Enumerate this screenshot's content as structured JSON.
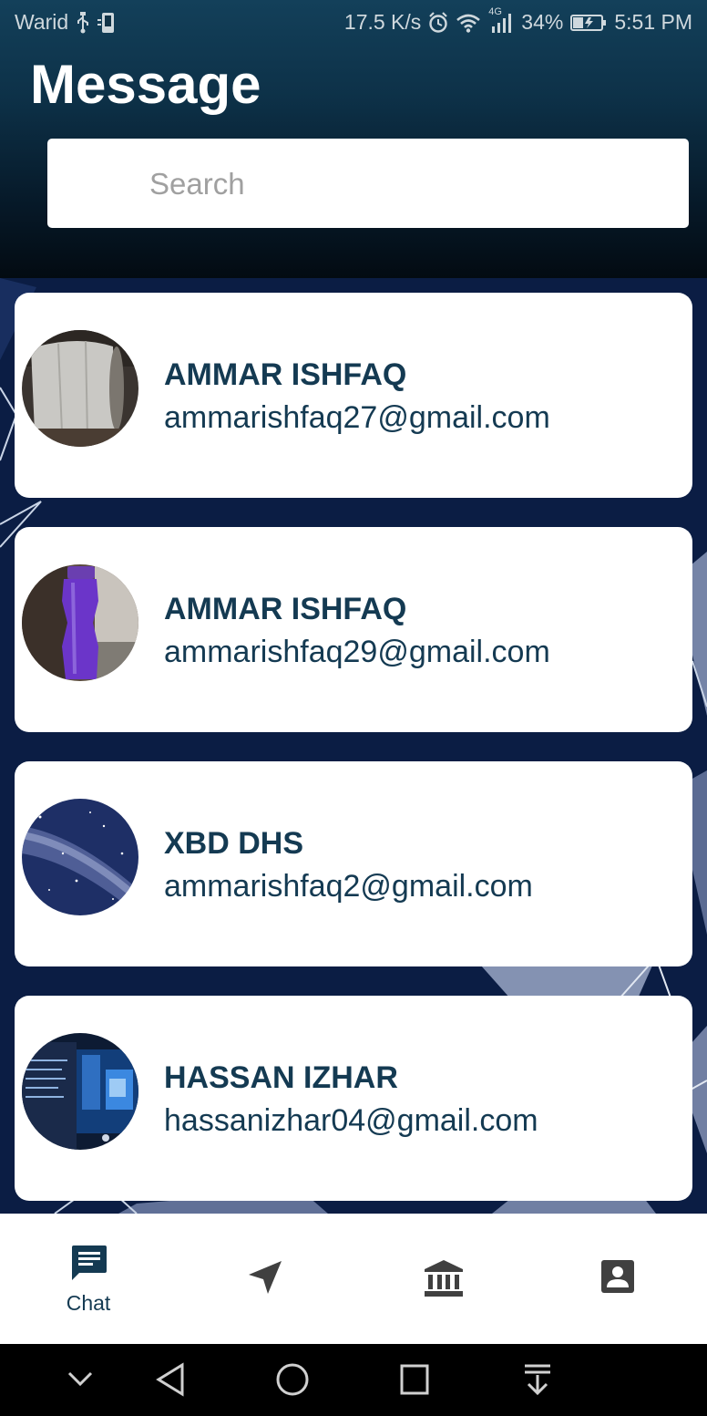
{
  "status_bar": {
    "carrier": "Warid",
    "speed": "17.5 K/s",
    "network": "4G",
    "battery": "34%",
    "time": "5:51 PM"
  },
  "header": {
    "title": "Message"
  },
  "search": {
    "placeholder": "Search"
  },
  "contacts": [
    {
      "name": "AMMAR ISHFAQ",
      "email": "ammarishfaq27@gmail.com",
      "avatar": "photo-tissue-roll"
    },
    {
      "name": "AMMAR ISHFAQ",
      "email": "ammarishfaq29@gmail.com",
      "avatar": "photo-purple-bottle"
    },
    {
      "name": "XBD DHS",
      "email": "ammarishfaq2@gmail.com",
      "avatar": "photo-milky-way"
    },
    {
      "name": "HASSAN IZHAR",
      "email": "hassanizhar04@gmail.com",
      "avatar": "photo-laptop-screen"
    }
  ],
  "bottom_nav": {
    "items": [
      {
        "label": "Chat",
        "icon": "chat-icon",
        "active": true
      },
      {
        "label": "",
        "icon": "navigation-icon",
        "active": false
      },
      {
        "label": "",
        "icon": "bank-icon",
        "active": false
      },
      {
        "label": "",
        "icon": "contact-card-icon",
        "active": false
      }
    ]
  },
  "colors": {
    "accent": "#143a52",
    "list_background": "#0b1d44",
    "card": "#ffffff"
  }
}
